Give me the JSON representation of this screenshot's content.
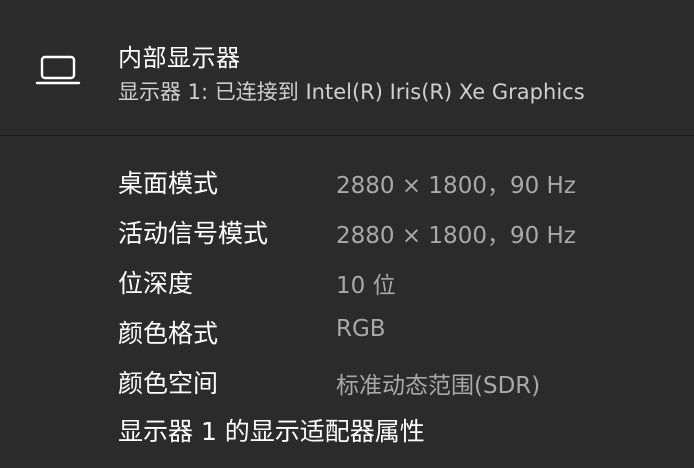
{
  "header": {
    "icon": "laptop-icon",
    "title": "内部显示器",
    "subtitle": "显示器 1: 已连接到 Intel(R) Iris(R) Xe Graphics"
  },
  "details": [
    {
      "label": "桌面模式",
      "value": "2880 × 1800，90 Hz"
    },
    {
      "label": "活动信号模式",
      "value": "2880 × 1800，90 Hz"
    },
    {
      "label": "位深度",
      "value": "10 位"
    },
    {
      "label": "颜色格式",
      "value": "RGB"
    },
    {
      "label": "颜色空间",
      "value": "标准动态范围(SDR)"
    }
  ],
  "adapter_link": "显示器 1 的显示适配器属性",
  "colors": {
    "background": "#2b2b2b",
    "title": "#ffffff",
    "value": "#a8a8a8"
  }
}
